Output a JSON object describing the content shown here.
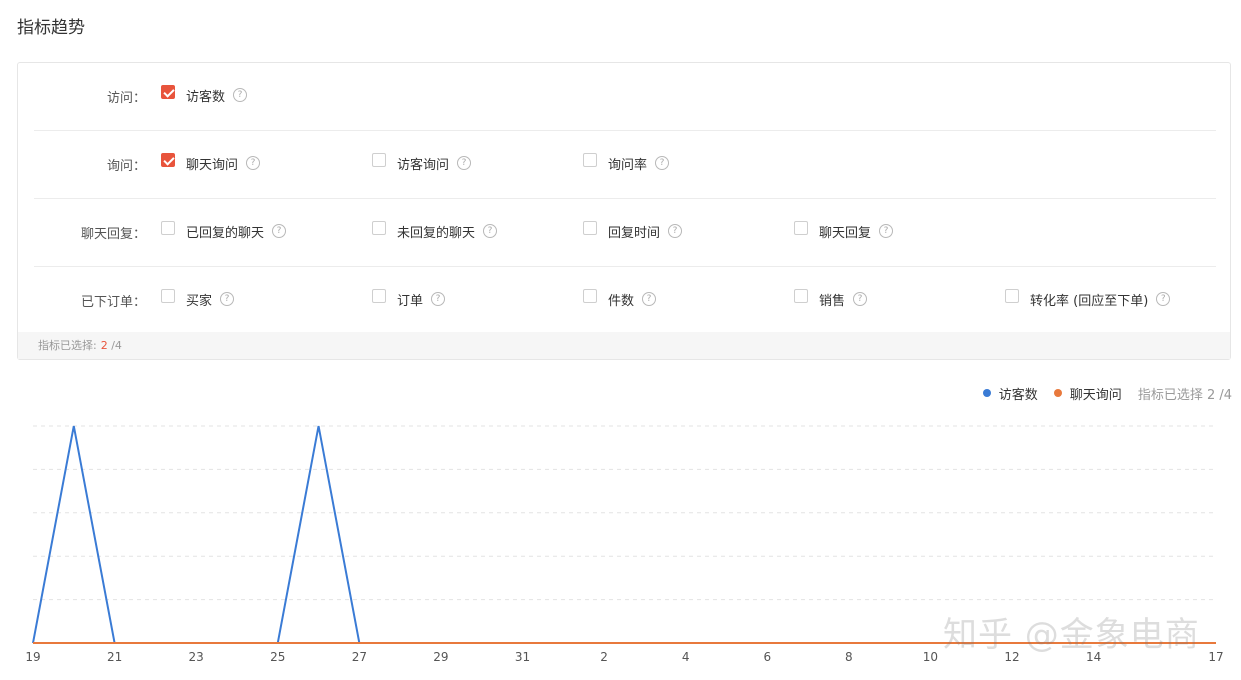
{
  "page_title": "指标趋势",
  "help_glyph": "?",
  "rows": [
    {
      "label": "访问：",
      "options": [
        {
          "label": "访客数",
          "checked": true
        }
      ]
    },
    {
      "label": "询问：",
      "options": [
        {
          "label": "聊天询问",
          "checked": true
        },
        {
          "label": "访客询问",
          "checked": false
        },
        {
          "label": "询问率",
          "checked": false
        }
      ]
    },
    {
      "label": "聊天回复：",
      "options": [
        {
          "label": "已回复的聊天",
          "checked": false
        },
        {
          "label": "未回复的聊天",
          "checked": false
        },
        {
          "label": "回复时间",
          "checked": false
        },
        {
          "label": "聊天回复",
          "checked": false
        }
      ]
    },
    {
      "label": "已下订单：",
      "options": [
        {
          "label": "买家",
          "checked": false
        },
        {
          "label": "订单",
          "checked": false
        },
        {
          "label": "件数",
          "checked": false
        },
        {
          "label": "销售",
          "checked": false
        },
        {
          "label": "转化率 (回应至下单)",
          "checked": false
        }
      ]
    }
  ],
  "footer": {
    "label": "指标已选择:",
    "selected": "2",
    "total": "/4"
  },
  "legend": {
    "meta": "指标已选择 2 /4"
  },
  "chart_data": {
    "type": "line",
    "x": [
      "19",
      "20",
      "21",
      "22",
      "23",
      "24",
      "25",
      "26",
      "27",
      "28",
      "29",
      "30",
      "31",
      "1",
      "2",
      "3",
      "4",
      "5",
      "6",
      "7",
      "8",
      "9",
      "10",
      "11",
      "12",
      "13",
      "14",
      "15",
      "16",
      "17"
    ],
    "tick_labels": [
      "19",
      "21",
      "23",
      "25",
      "27",
      "29",
      "31",
      "2",
      "4",
      "6",
      "8",
      "10",
      "12",
      "14",
      "17"
    ],
    "ylim": [
      0,
      5
    ],
    "grid": true,
    "legend_position": "top-right",
    "series": [
      {
        "name": "访客数",
        "color": "#3a7bd5",
        "values": [
          0,
          5,
          0,
          0,
          0,
          0,
          0,
          5,
          0,
          0,
          0,
          0,
          0,
          0,
          0,
          0,
          0,
          0,
          0,
          0,
          0,
          0,
          0,
          0,
          0,
          0,
          0,
          0,
          0,
          0
        ]
      },
      {
        "name": "聊天询问",
        "color": "#e8793c",
        "values": [
          0,
          0,
          0,
          0,
          0,
          0,
          0,
          0,
          0,
          0,
          0,
          0,
          0,
          0,
          0,
          0,
          0,
          0,
          0,
          0,
          0,
          0,
          0,
          0,
          0,
          0,
          0,
          0,
          0,
          0
        ]
      }
    ]
  },
  "watermark": "知乎 @金象电商"
}
